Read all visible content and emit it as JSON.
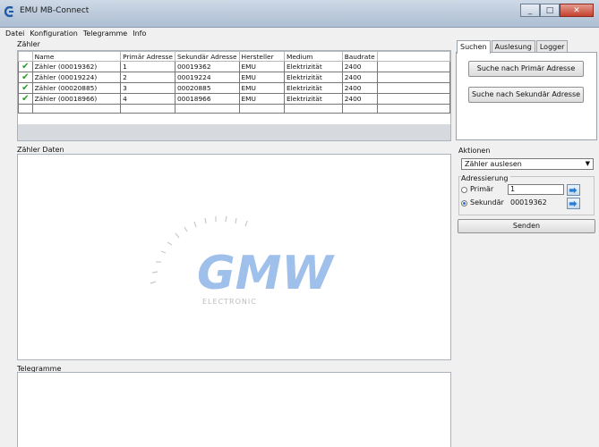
{
  "window": {
    "title": "EMU MB-Connect",
    "minimize": "_",
    "maximize": "□",
    "close": "✕"
  },
  "menu": [
    "Datei",
    "Konfiguration",
    "Telegramme",
    "Info"
  ],
  "zaehler": {
    "label": "Zähler",
    "columns": [
      "",
      "Name",
      "Primär Adresse",
      "Sekundär Adresse",
      "Hersteller",
      "Medium",
      "Baudrate",
      ""
    ],
    "rows": [
      {
        "check": "✔",
        "name": "Zähler (00019362)",
        "primaer": "1",
        "sekundaer": "00019362",
        "hersteller": "EMU",
        "medium": "Elektrizität",
        "baudrate": "2400"
      },
      {
        "check": "✔",
        "name": "Zähler (00019224)",
        "primaer": "2",
        "sekundaer": "00019224",
        "hersteller": "EMU",
        "medium": "Elektrizität",
        "baudrate": "2400"
      },
      {
        "check": "✔",
        "name": "Zähler (00020885)",
        "primaer": "3",
        "sekundaer": "00020885",
        "hersteller": "EMU",
        "medium": "Elektrizität",
        "baudrate": "2400"
      },
      {
        "check": "✔",
        "name": "Zähler (00018966)",
        "primaer": "4",
        "sekundaer": "00018966",
        "hersteller": "EMU",
        "medium": "Elektrizität",
        "baudrate": "2400"
      }
    ]
  },
  "tabs": {
    "suchen": "Suchen",
    "auslesung": "Auslesung",
    "logger": "Logger"
  },
  "search": {
    "primaer_button": "Suche nach Primär Adresse",
    "sekundaer_button": "Suche nach Sekundär Adresse"
  },
  "daten": {
    "label": "Zähler Daten",
    "watermark_logo": "GMW",
    "watermark_sub": "ELECTRONIC"
  },
  "telegramme": {
    "label": "Telegramme"
  },
  "aktionen": {
    "label": "Aktionen",
    "selected_action": "Zähler auslesen",
    "adressierung_label": "Adressierung",
    "primaer_label": "Primär",
    "primaer_value": "1",
    "sekundaer_label": "Sekundär",
    "sekundaer_value": "00019362",
    "send_button": "Senden"
  },
  "colors": {
    "check": "#2a9a2a",
    "watermark": "#9ec0ea"
  }
}
